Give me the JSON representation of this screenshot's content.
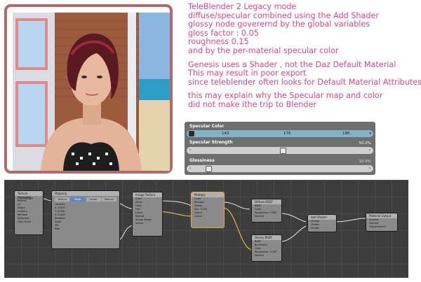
{
  "notes": {
    "block1": [
      "TeleBlender 2 Legacy mode",
      "diffuse/specular combined using the  Add Shader",
      "glossy node goverernd by the global variables",
      "gloss factor : 0.05",
      "roughness 0.15",
      "and by the per-material specular color"
    ],
    "block2": [
      "Genesis uses a Shader , not the Daz Default Material",
      "This may result in poor export",
      "since teleblender often looks for  Default Material Attributes"
    ],
    "block3": [
      "this may explain why the Specular map and color",
      "did not make ithe trip to Blender"
    ]
  },
  "panel": {
    "specular_color": {
      "title": "Specular Color",
      "values": [
        "143",
        "176",
        "186"
      ]
    },
    "specular_strength": {
      "title": "Specular Strength",
      "value": "50.0%",
      "level": 0.5
    },
    "glossiness": {
      "title": "Glossiness",
      "value": "10.0%",
      "level": 0.1
    }
  },
  "nodes": {
    "texcoord": {
      "title": "Texture Coordinate",
      "rows": [
        "Generated",
        "Normal",
        "UV",
        "Object",
        "Camera",
        "Window",
        "Reflection",
        "From Dupli"
      ]
    },
    "mapping": {
      "title": "Mapping",
      "tabs": [
        "Texture",
        "Point",
        "Vector",
        "Normal"
      ],
      "rows": [
        "Location",
        "X:  0.000",
        "Y:  0.000",
        "Z:  0.000",
        "Rotation",
        "Scale",
        "Min",
        "Max"
      ]
    },
    "image_texture": {
      "title": "Image Texture",
      "rows": [
        "Color",
        "Alpha",
        "Color",
        "Flat",
        "Linear",
        "Repeat",
        "Single Image",
        "Vector"
      ]
    },
    "multiply": {
      "title": "Multiply",
      "rows": [
        "Color",
        "Multiply",
        "Clamp",
        "Fac:  1.000",
        "Color1",
        "Color2"
      ]
    },
    "diffuse_bsdf": {
      "title": "Diffuse BSDF",
      "rows": [
        "BSDF",
        "Color",
        "Roughness:  0.000",
        "Normal"
      ]
    },
    "glossy_bsdf": {
      "title": "Glossy BSDF",
      "rows": [
        "BSDF",
        "Beckmann",
        "Color",
        "Roughness:  0.150",
        "Normal"
      ]
    },
    "add_shader": {
      "title": "Add Shader",
      "rows": [
        "Shader",
        "Shader",
        "Shader"
      ]
    },
    "material_output": {
      "title": "Material Output",
      "rows": [
        "Surface",
        "Volume",
        "Displacement"
      ]
    }
  },
  "colors": {
    "note_text": "#d64a8c",
    "frame": "#b06a6a",
    "node_active": "#f2a13a"
  }
}
